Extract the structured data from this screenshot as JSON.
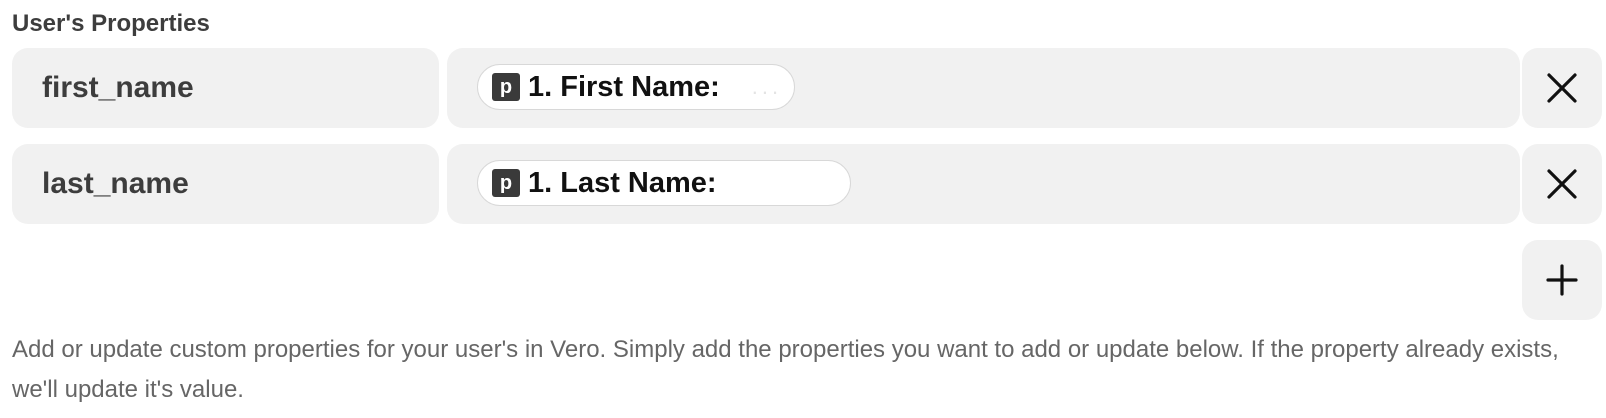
{
  "section": {
    "label": "User's Properties"
  },
  "rows": [
    {
      "key": "first_name",
      "value_pill": {
        "app_icon": "p-app-badge",
        "app_letter": "p",
        "label": "1. First Name:",
        "trailing": "..."
      },
      "remove_icon": "close-icon"
    },
    {
      "key": "last_name",
      "value_pill": {
        "app_icon": "p-app-badge",
        "app_letter": "p",
        "label": "1. Last Name:"
      },
      "remove_icon": "close-icon"
    }
  ],
  "add_icon": "plus-icon",
  "help_text": "Add or update custom properties for your user's in Vero. Simply add the properties you want to add or update below. If the property already exists, we'll update it's value.",
  "colors": {
    "field_bg": "#f1f1f1",
    "pill_bg": "#ffffff",
    "badge_bg": "#3a3a3a"
  }
}
